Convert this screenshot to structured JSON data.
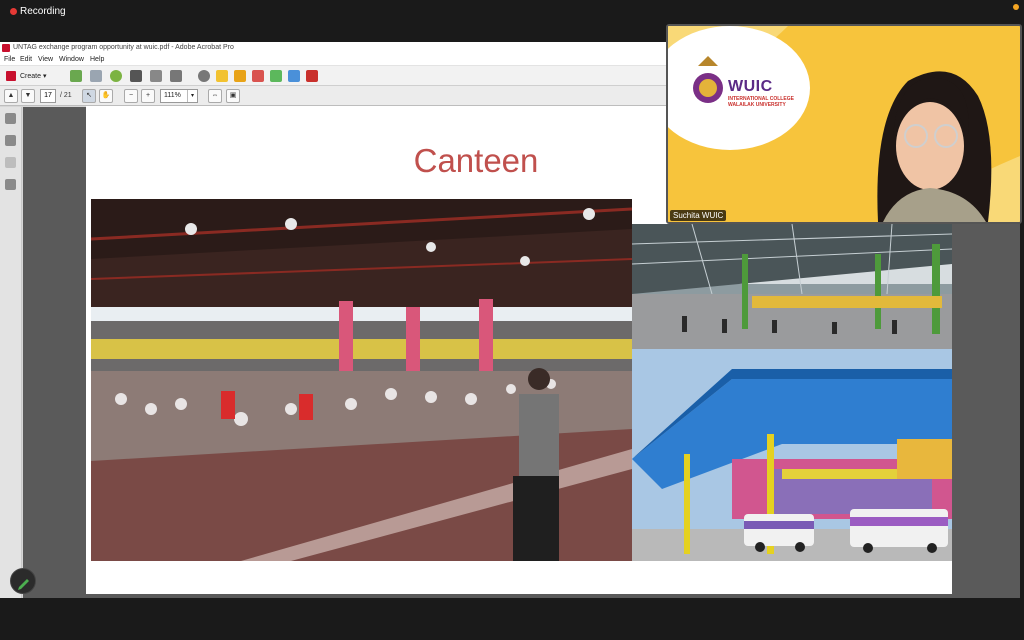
{
  "recording": {
    "label": "Recording"
  },
  "acrobat": {
    "window_title": "UNTAG exchange program opportunity at wuic.pdf - Adobe Acrobat Pro",
    "menu": [
      "File",
      "Edit",
      "View",
      "Window",
      "Help"
    ],
    "create_label": "Create",
    "page": {
      "current": "17",
      "total": "/ 21"
    },
    "zoom": "111%"
  },
  "slide": {
    "title": "Canteen"
  },
  "video": {
    "participant_name": "Suchita WUIC",
    "logo_main": "WUIC",
    "logo_sub1": "INTERNATIONAL COLLEGE",
    "logo_sub2": "WALAILAK UNIVERSITY"
  },
  "colors": {
    "title": "#c0504d",
    "recording_dot": "#e53935",
    "video_bg": "#f7c43c",
    "logo_purple": "#5b2a86"
  }
}
